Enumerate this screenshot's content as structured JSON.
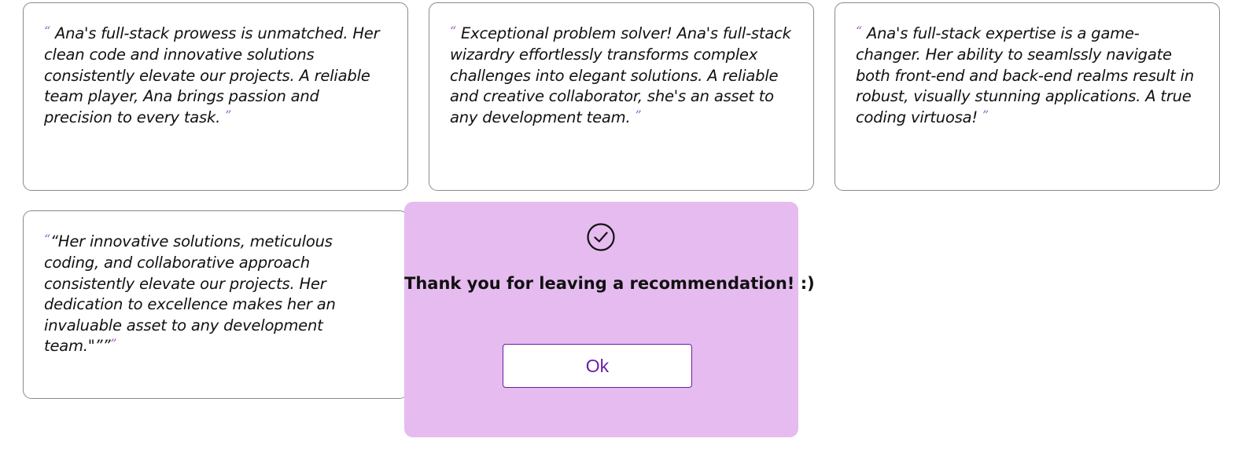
{
  "recommendations": [
    {
      "open_mark": "“",
      "text": "Ana's full-stack prowess is unmatched. Her clean code and innovative solutions consistently elevate our projects. A reliable team player, Ana brings passion and precision to every task.",
      "close_mark": "”"
    },
    {
      "open_mark": "“",
      "text": "Exceptional problem solver! Ana's full-stack wizardry effortlessly transforms complex challenges into elegant solutions. A reliable and creative collaborator, she's an asset to any development team.",
      "close_mark": "”"
    },
    {
      "open_mark": "“",
      "text": "Ana's full-stack expertise is a game-changer. Her ability to seamlssly navigate both front-end and back-end realms result in robust, visually stunning applications. A true coding virtuosa!",
      "close_mark": "”"
    },
    {
      "open_mark": "“",
      "text": "“Her innovative solutions, meticulous coding, and collaborative approach consistently elevate our projects. Her dedication to excellence makes her an invaluable asset to any development team.\"””",
      "close_mark": "”"
    }
  ],
  "modal": {
    "icon": "check-circle-icon",
    "message": "Thank you for leaving a recommendation! :)",
    "ok_label": "Ok"
  },
  "colors": {
    "modal_background": "#e6bbf0",
    "accent": "#6a1ca8",
    "quote_mark": "#9b59d0"
  }
}
